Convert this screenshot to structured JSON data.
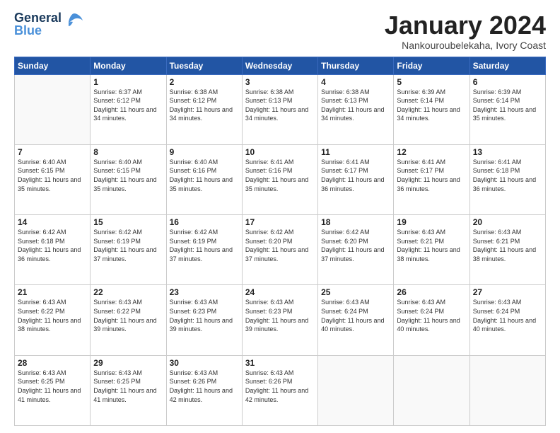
{
  "logo": {
    "line1": "General",
    "line2": "Blue"
  },
  "title": "January 2024",
  "location": "Nankouroubelekaha, Ivory Coast",
  "weekdays": [
    "Sunday",
    "Monday",
    "Tuesday",
    "Wednesday",
    "Thursday",
    "Friday",
    "Saturday"
  ],
  "weeks": [
    [
      {
        "day": "",
        "sunrise": "",
        "sunset": "",
        "daylight": ""
      },
      {
        "day": "1",
        "sunrise": "Sunrise: 6:37 AM",
        "sunset": "Sunset: 6:12 PM",
        "daylight": "Daylight: 11 hours and 34 minutes."
      },
      {
        "day": "2",
        "sunrise": "Sunrise: 6:38 AM",
        "sunset": "Sunset: 6:12 PM",
        "daylight": "Daylight: 11 hours and 34 minutes."
      },
      {
        "day": "3",
        "sunrise": "Sunrise: 6:38 AM",
        "sunset": "Sunset: 6:13 PM",
        "daylight": "Daylight: 11 hours and 34 minutes."
      },
      {
        "day": "4",
        "sunrise": "Sunrise: 6:38 AM",
        "sunset": "Sunset: 6:13 PM",
        "daylight": "Daylight: 11 hours and 34 minutes."
      },
      {
        "day": "5",
        "sunrise": "Sunrise: 6:39 AM",
        "sunset": "Sunset: 6:14 PM",
        "daylight": "Daylight: 11 hours and 34 minutes."
      },
      {
        "day": "6",
        "sunrise": "Sunrise: 6:39 AM",
        "sunset": "Sunset: 6:14 PM",
        "daylight": "Daylight: 11 hours and 35 minutes."
      }
    ],
    [
      {
        "day": "7",
        "sunrise": "Sunrise: 6:40 AM",
        "sunset": "Sunset: 6:15 PM",
        "daylight": "Daylight: 11 hours and 35 minutes."
      },
      {
        "day": "8",
        "sunrise": "Sunrise: 6:40 AM",
        "sunset": "Sunset: 6:15 PM",
        "daylight": "Daylight: 11 hours and 35 minutes."
      },
      {
        "day": "9",
        "sunrise": "Sunrise: 6:40 AM",
        "sunset": "Sunset: 6:16 PM",
        "daylight": "Daylight: 11 hours and 35 minutes."
      },
      {
        "day": "10",
        "sunrise": "Sunrise: 6:41 AM",
        "sunset": "Sunset: 6:16 PM",
        "daylight": "Daylight: 11 hours and 35 minutes."
      },
      {
        "day": "11",
        "sunrise": "Sunrise: 6:41 AM",
        "sunset": "Sunset: 6:17 PM",
        "daylight": "Daylight: 11 hours and 36 minutes."
      },
      {
        "day": "12",
        "sunrise": "Sunrise: 6:41 AM",
        "sunset": "Sunset: 6:17 PM",
        "daylight": "Daylight: 11 hours and 36 minutes."
      },
      {
        "day": "13",
        "sunrise": "Sunrise: 6:41 AM",
        "sunset": "Sunset: 6:18 PM",
        "daylight": "Daylight: 11 hours and 36 minutes."
      }
    ],
    [
      {
        "day": "14",
        "sunrise": "Sunrise: 6:42 AM",
        "sunset": "Sunset: 6:18 PM",
        "daylight": "Daylight: 11 hours and 36 minutes."
      },
      {
        "day": "15",
        "sunrise": "Sunrise: 6:42 AM",
        "sunset": "Sunset: 6:19 PM",
        "daylight": "Daylight: 11 hours and 37 minutes."
      },
      {
        "day": "16",
        "sunrise": "Sunrise: 6:42 AM",
        "sunset": "Sunset: 6:19 PM",
        "daylight": "Daylight: 11 hours and 37 minutes."
      },
      {
        "day": "17",
        "sunrise": "Sunrise: 6:42 AM",
        "sunset": "Sunset: 6:20 PM",
        "daylight": "Daylight: 11 hours and 37 minutes."
      },
      {
        "day": "18",
        "sunrise": "Sunrise: 6:42 AM",
        "sunset": "Sunset: 6:20 PM",
        "daylight": "Daylight: 11 hours and 37 minutes."
      },
      {
        "day": "19",
        "sunrise": "Sunrise: 6:43 AM",
        "sunset": "Sunset: 6:21 PM",
        "daylight": "Daylight: 11 hours and 38 minutes."
      },
      {
        "day": "20",
        "sunrise": "Sunrise: 6:43 AM",
        "sunset": "Sunset: 6:21 PM",
        "daylight": "Daylight: 11 hours and 38 minutes."
      }
    ],
    [
      {
        "day": "21",
        "sunrise": "Sunrise: 6:43 AM",
        "sunset": "Sunset: 6:22 PM",
        "daylight": "Daylight: 11 hours and 38 minutes."
      },
      {
        "day": "22",
        "sunrise": "Sunrise: 6:43 AM",
        "sunset": "Sunset: 6:22 PM",
        "daylight": "Daylight: 11 hours and 39 minutes."
      },
      {
        "day": "23",
        "sunrise": "Sunrise: 6:43 AM",
        "sunset": "Sunset: 6:23 PM",
        "daylight": "Daylight: 11 hours and 39 minutes."
      },
      {
        "day": "24",
        "sunrise": "Sunrise: 6:43 AM",
        "sunset": "Sunset: 6:23 PM",
        "daylight": "Daylight: 11 hours and 39 minutes."
      },
      {
        "day": "25",
        "sunrise": "Sunrise: 6:43 AM",
        "sunset": "Sunset: 6:24 PM",
        "daylight": "Daylight: 11 hours and 40 minutes."
      },
      {
        "day": "26",
        "sunrise": "Sunrise: 6:43 AM",
        "sunset": "Sunset: 6:24 PM",
        "daylight": "Daylight: 11 hours and 40 minutes."
      },
      {
        "day": "27",
        "sunrise": "Sunrise: 6:43 AM",
        "sunset": "Sunset: 6:24 PM",
        "daylight": "Daylight: 11 hours and 40 minutes."
      }
    ],
    [
      {
        "day": "28",
        "sunrise": "Sunrise: 6:43 AM",
        "sunset": "Sunset: 6:25 PM",
        "daylight": "Daylight: 11 hours and 41 minutes."
      },
      {
        "day": "29",
        "sunrise": "Sunrise: 6:43 AM",
        "sunset": "Sunset: 6:25 PM",
        "daylight": "Daylight: 11 hours and 41 minutes."
      },
      {
        "day": "30",
        "sunrise": "Sunrise: 6:43 AM",
        "sunset": "Sunset: 6:26 PM",
        "daylight": "Daylight: 11 hours and 42 minutes."
      },
      {
        "day": "31",
        "sunrise": "Sunrise: 6:43 AM",
        "sunset": "Sunset: 6:26 PM",
        "daylight": "Daylight: 11 hours and 42 minutes."
      },
      {
        "day": "",
        "sunrise": "",
        "sunset": "",
        "daylight": ""
      },
      {
        "day": "",
        "sunrise": "",
        "sunset": "",
        "daylight": ""
      },
      {
        "day": "",
        "sunrise": "",
        "sunset": "",
        "daylight": ""
      }
    ]
  ]
}
